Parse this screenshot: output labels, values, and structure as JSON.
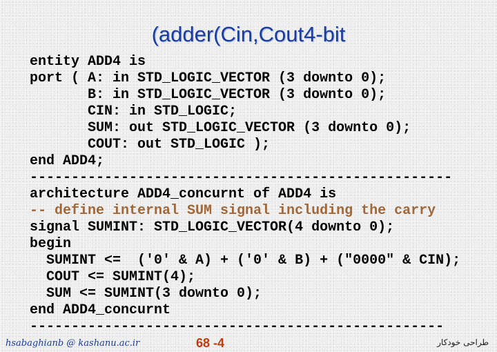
{
  "slide": {
    "title": "(adder(Cin,Cout4-bit",
    "code_lines": [
      {
        "text": "entity ADD4 is",
        "kind": "code"
      },
      {
        "text": "port ( A: in STD_LOGIC_VECTOR (3 downto 0);",
        "kind": "code"
      },
      {
        "text": "       B: in STD_LOGIC_VECTOR (3 downto 0);",
        "kind": "code"
      },
      {
        "text": "       CIN: in STD_LOGIC;",
        "kind": "code"
      },
      {
        "text": "       SUM: out STD_LOGIC_VECTOR (3 downto 0);",
        "kind": "code"
      },
      {
        "text": "       COUT: out STD_LOGIC );",
        "kind": "code"
      },
      {
        "text": "end ADD4;",
        "kind": "code"
      },
      {
        "text": "---------------------------------------------------",
        "kind": "separator"
      },
      {
        "text": "architecture ADD4_concurnt of ADD4 is",
        "kind": "code"
      },
      {
        "text": "-- define internal SUM signal including the carry",
        "kind": "comment"
      },
      {
        "text": "signal SUMINT: STD_LOGIC_VECTOR(4 downto 0);",
        "kind": "code"
      },
      {
        "text": "begin",
        "kind": "code"
      },
      {
        "text": "  SUMINT <=  ('0' & A) + ('0' & B) + (\"0000\" & CIN);",
        "kind": "code"
      },
      {
        "text": "  COUT <= SUMINT(4);",
        "kind": "code"
      },
      {
        "text": "  SUM <= SUMINT(3 downto 0);",
        "kind": "code"
      },
      {
        "text": "end ADD4_concurnt",
        "kind": "code"
      },
      {
        "text": "--------------------------------------------------",
        "kind": "separator"
      }
    ]
  },
  "footer": {
    "email": "hsabaghianb @ kashanu.ac.ir",
    "page": "68 -4",
    "course": "طراحی خودکار"
  },
  "colors": {
    "title": "#1a3d9e",
    "comment": "#a0683a",
    "page_number": "#c03a0e"
  }
}
